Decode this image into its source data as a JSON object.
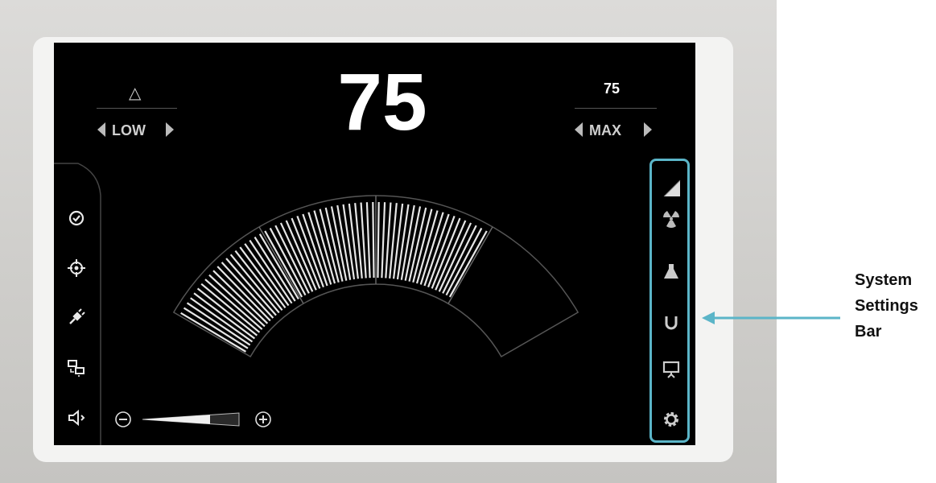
{
  "display": {
    "value": "75",
    "low": {
      "symbol": "△",
      "label": "LOW"
    },
    "max": {
      "value": "75",
      "label": "MAX"
    }
  },
  "gauge": {
    "level_fraction": 0.75
  },
  "volume": {
    "level_fraction": 0.7
  },
  "left_bar": {
    "icons": [
      "check-circle-icon",
      "target-icon",
      "plug-icon",
      "screens-icon",
      "speaker-icon"
    ]
  },
  "settings_bar": {
    "icons": [
      "corner-fold-icon",
      "radiation-icon",
      "flask-icon",
      "magnet-icon",
      "presentation-icon",
      "gear-icon"
    ],
    "highlight_color": "#5bb5c8"
  },
  "annotation": {
    "line1": "System",
    "line2": "Settings",
    "line3": "Bar"
  },
  "colors": {
    "screen": "#000000",
    "accent": "#5bb5c8",
    "segment": "#e6e6e6"
  }
}
